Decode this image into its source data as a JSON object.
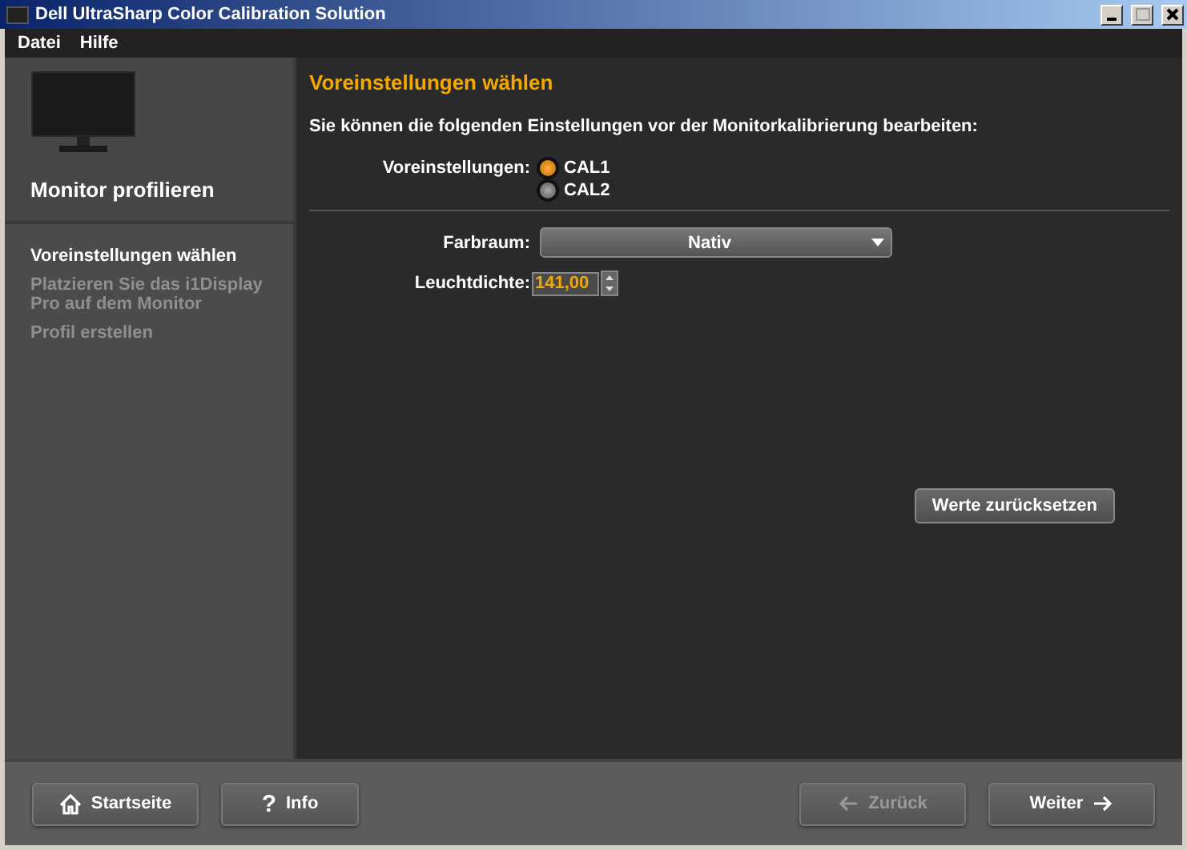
{
  "window": {
    "title": "Dell UltraSharp Color Calibration Solution"
  },
  "menu": [
    "Datei",
    "Hilfe"
  ],
  "sidebar": {
    "heading": "Monitor profilieren",
    "steps": [
      {
        "label": "Voreinstellungen wählen",
        "selected": true
      },
      {
        "label": "Platzieren Sie das i1Display Pro auf dem Monitor",
        "selected": false
      },
      {
        "label": "Profil erstellen",
        "selected": false
      }
    ]
  },
  "content": {
    "title": "Voreinstellungen wählen",
    "intro": "Sie können die folgenden Einstellungen vor der Monitorkalibrierung bearbeiten:",
    "presets": {
      "label": "Voreinstellungen:",
      "options": [
        {
          "label": "CAL1",
          "selected": true
        },
        {
          "label": "CAL2",
          "selected": false
        }
      ]
    },
    "color_space": {
      "label": "Farbraum:",
      "value": "Nativ"
    },
    "luminance": {
      "label": "Leuchtdichte:",
      "value": "141,00"
    },
    "reset_button": "Werte zurücksetzen"
  },
  "footer": {
    "buttons": [
      {
        "kind": "home",
        "label": "Startseite",
        "disabled": false
      },
      {
        "kind": "help",
        "symbol": "?",
        "label": "Info",
        "disabled": false
      },
      {
        "kind": "back",
        "label": "Zurück",
        "disabled": true
      },
      {
        "kind": "next",
        "label": "Weiter",
        "disabled": false
      }
    ]
  }
}
